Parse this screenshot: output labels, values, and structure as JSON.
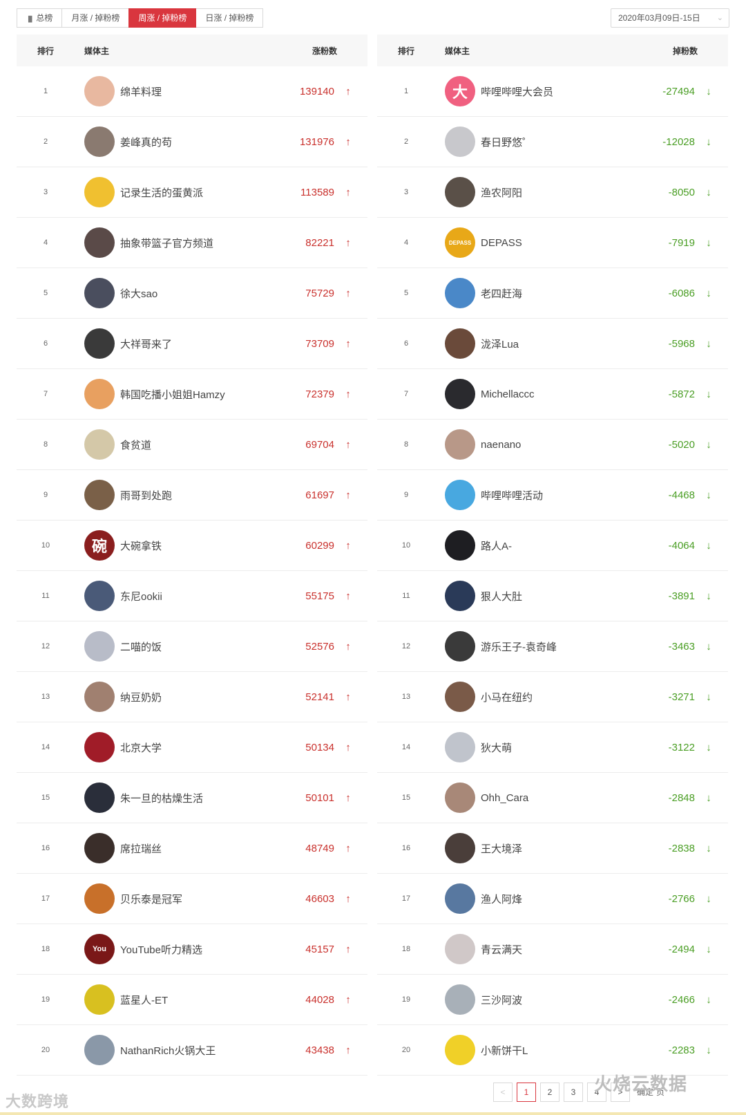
{
  "tabs": [
    {
      "label": "总榜",
      "icon": "bar-chart-icon",
      "active": false
    },
    {
      "label": "月涨 / 掉粉榜",
      "active": false
    },
    {
      "label": "周涨 / 掉粉榜",
      "active": true
    },
    {
      "label": "日涨 / 掉粉榜",
      "active": false
    }
  ],
  "date_range": "2020年03月09日-15日",
  "gain_table": {
    "headers": {
      "rank": "排行",
      "media": "媒体主",
      "count": "涨粉数"
    },
    "rows": [
      {
        "rank": "1",
        "name": "绵羊料理",
        "count": "139140",
        "color": "#e8b8a0"
      },
      {
        "rank": "2",
        "name": "姜峰真的苟",
        "count": "131976",
        "color": "#8a7a70"
      },
      {
        "rank": "3",
        "name": "记录生活的蛋黄派",
        "count": "113589",
        "color": "#f0c030"
      },
      {
        "rank": "4",
        "name": "抽象带篮子官方频道",
        "count": "82221",
        "color": "#5a4a48"
      },
      {
        "rank": "5",
        "name": "徐大sao",
        "count": "75729",
        "color": "#4a4e5e"
      },
      {
        "rank": "6",
        "name": "大祥哥来了",
        "count": "73709",
        "color": "#3a3a3a"
      },
      {
        "rank": "7",
        "name": "韩国吃播小姐姐Hamzy",
        "count": "72379",
        "color": "#e8a060"
      },
      {
        "rank": "8",
        "name": "食贫道",
        "count": "69704",
        "color": "#d4c8a8"
      },
      {
        "rank": "9",
        "name": "雨哥到处跑",
        "count": "61697",
        "color": "#7a6048"
      },
      {
        "rank": "10",
        "name": "大碗拿铁",
        "count": "60299",
        "color": "#8a1e1e",
        "text": "碗"
      },
      {
        "rank": "11",
        "name": "东尼ookii",
        "count": "55175",
        "color": "#4a5a78"
      },
      {
        "rank": "12",
        "name": "二喵的饭",
        "count": "52576",
        "color": "#b8bcc8"
      },
      {
        "rank": "13",
        "name": "纳豆奶奶",
        "count": "52141",
        "color": "#a08070"
      },
      {
        "rank": "14",
        "name": "北京大学",
        "count": "50134",
        "color": "#a01c28"
      },
      {
        "rank": "15",
        "name": "朱一旦的枯燥生活",
        "count": "50101",
        "color": "#2a2e3a"
      },
      {
        "rank": "16",
        "name": "席拉瑞丝",
        "count": "48749",
        "color": "#3a2e2a"
      },
      {
        "rank": "17",
        "name": "贝乐泰是冠军",
        "count": "46603",
        "color": "#c8702a"
      },
      {
        "rank": "18",
        "name": "YouTube听力精选",
        "count": "45157",
        "color": "#7a1818",
        "text": "You"
      },
      {
        "rank": "19",
        "name": "蓝星人-ET",
        "count": "44028",
        "color": "#d8c020"
      },
      {
        "rank": "20",
        "name": "NathanRich火锅大王",
        "count": "43438",
        "color": "#8a98a8"
      }
    ]
  },
  "loss_table": {
    "headers": {
      "rank": "排行",
      "media": "媒体主",
      "count": "掉粉数"
    },
    "rows": [
      {
        "rank": "1",
        "name": "哔哩哔哩大会员",
        "count": "-27494",
        "color": "#f06080",
        "text": "大"
      },
      {
        "rank": "2",
        "name": "春日野悠˚",
        "count": "-12028",
        "color": "#c8c8cc"
      },
      {
        "rank": "3",
        "name": "渔农阿阳",
        "count": "-8050",
        "color": "#5a5048"
      },
      {
        "rank": "4",
        "name": "DEPASS",
        "count": "-7919",
        "color": "#e8a818",
        "text": "DEPASS"
      },
      {
        "rank": "5",
        "name": "老四赶海",
        "count": "-6086",
        "color": "#4a88c8"
      },
      {
        "rank": "6",
        "name": "泷泽Lua",
        "count": "-5968",
        "color": "#6a4a3a"
      },
      {
        "rank": "7",
        "name": "Michellaccc",
        "count": "-5872",
        "color": "#2a2a2e"
      },
      {
        "rank": "8",
        "name": "naenano",
        "count": "-5020",
        "color": "#b89888"
      },
      {
        "rank": "9",
        "name": "哔哩哔哩活动",
        "count": "-4468",
        "color": "#48a8e0"
      },
      {
        "rank": "10",
        "name": "路人A-",
        "count": "-4064",
        "color": "#1e1e22"
      },
      {
        "rank": "11",
        "name": "狠人大肚",
        "count": "-3891",
        "color": "#2a3a58"
      },
      {
        "rank": "12",
        "name": "游乐王子-袁奇峰",
        "count": "-3463",
        "color": "#3a3a3a"
      },
      {
        "rank": "13",
        "name": "小马在纽约",
        "count": "-3271",
        "color": "#7a5a48"
      },
      {
        "rank": "14",
        "name": "狄大萌",
        "count": "-3122",
        "color": "#c0c4cc"
      },
      {
        "rank": "15",
        "name": "Ohh_Cara",
        "count": "-2848",
        "color": "#a88878"
      },
      {
        "rank": "16",
        "name": "王大境泽",
        "count": "-2838",
        "color": "#4a3e3a"
      },
      {
        "rank": "17",
        "name": "渔人阿烽",
        "count": "-2766",
        "color": "#5878a0"
      },
      {
        "rank": "18",
        "name": "青云满天",
        "count": "-2494",
        "color": "#d0c8c8"
      },
      {
        "rank": "19",
        "name": "三沙阿波",
        "count": "-2466",
        "color": "#a8b0b8"
      },
      {
        "rank": "20",
        "name": "小新饼干L",
        "count": "-2283",
        "color": "#f0d028"
      }
    ]
  },
  "pagination": {
    "pages": [
      "1",
      "2",
      "3",
      "4"
    ],
    "current": "1",
    "jump_label": "确定",
    "page_suffix": "页"
  },
  "watermarks": {
    "left": "大数跨境",
    "right": "火烧云数据"
  }
}
